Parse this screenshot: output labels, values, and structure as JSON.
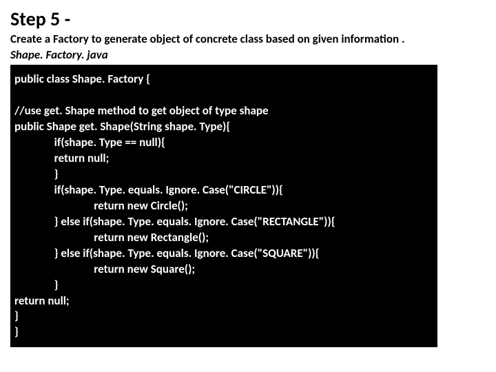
{
  "header": {
    "title": "Step 5 -",
    "description": "Create a Factory to generate object of concrete class based on given information .",
    "filename": "Shape. Factory. java"
  },
  "code": {
    "line1": "public class Shape. Factory {",
    "line2": "",
    "line3": "//use get. Shape method to get object of type shape",
    "line4": "public Shape get. Shape(String shape. Type){",
    "line5": "               if(shape. Type == null){",
    "line6": "               return null;",
    "line7": "               }",
    "line8": "               if(shape. Type. equals. Ignore. Case(\"CIRCLE\")){",
    "line9": "                              return new Circle();",
    "line10": "               } else if(shape. Type. equals. Ignore. Case(\"RECTANGLE\")){",
    "line11": "                              return new Rectangle();",
    "line12": "               } else if(shape. Type. equals. Ignore. Case(\"SQUARE\")){",
    "line13": "                              return new Square();",
    "line14": "               }",
    "line15": "return null;",
    "line16": "}",
    "line17": "}"
  }
}
